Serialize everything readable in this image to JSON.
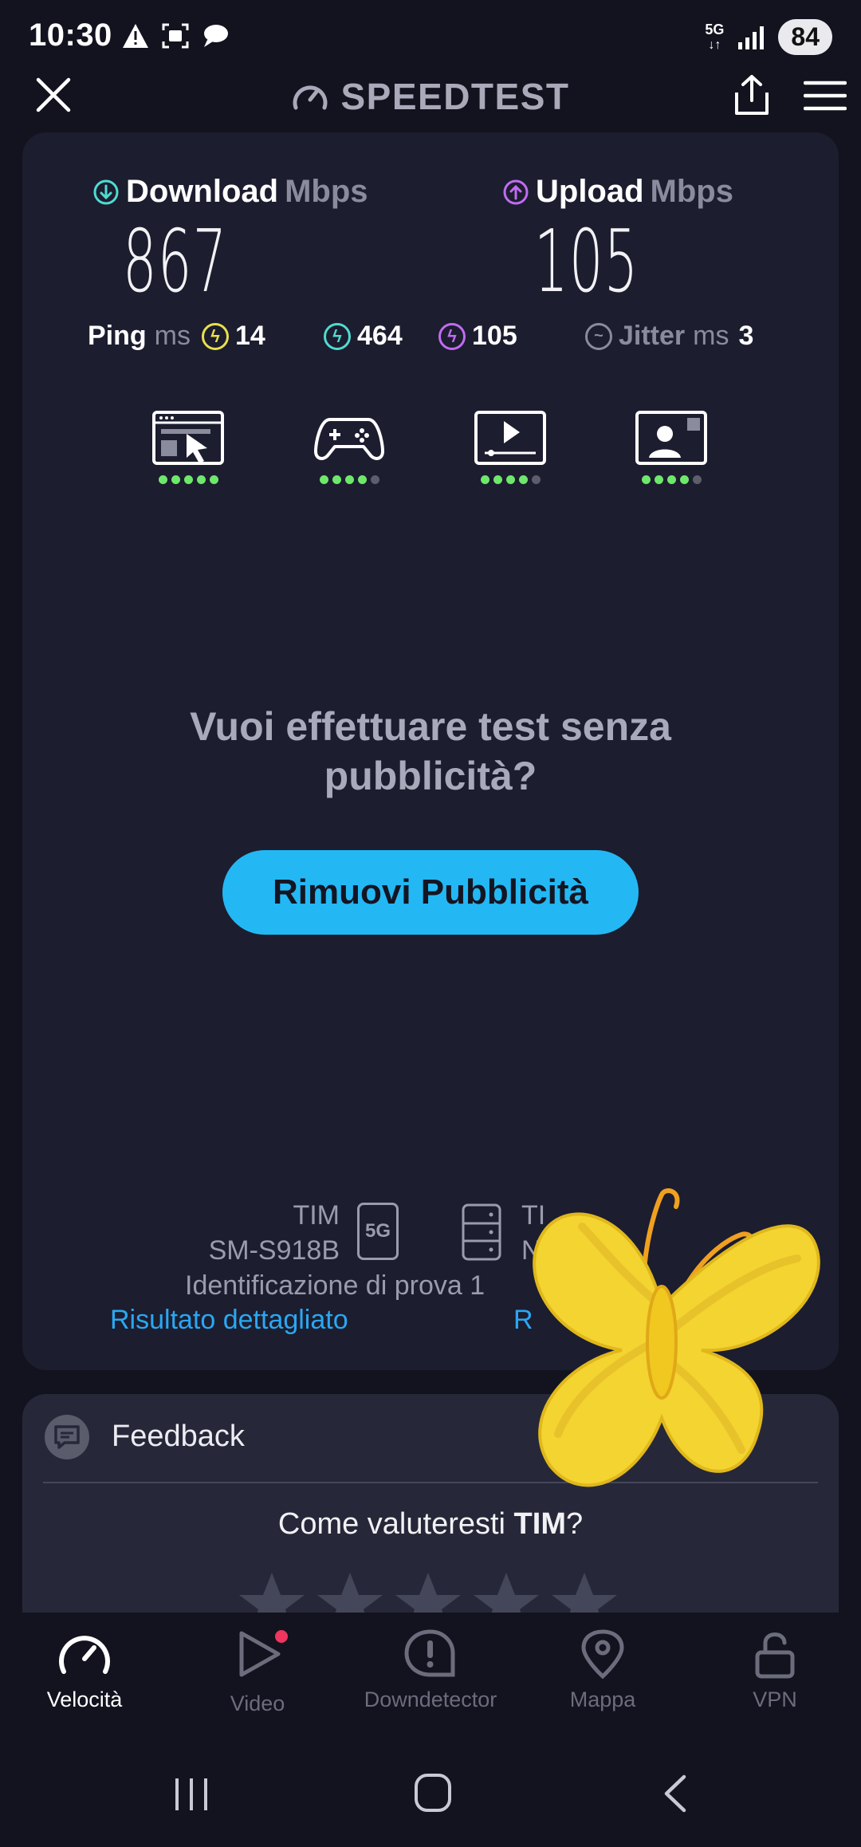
{
  "status_bar": {
    "time": "10:30",
    "battery": "84",
    "network": "5G"
  },
  "header": {
    "title": "SPEEDTEST",
    "icons": [
      "close-icon",
      "speedometer-icon",
      "share-icon",
      "menu-icon"
    ]
  },
  "results": {
    "download": {
      "label": "Download",
      "unit": "Mbps",
      "value": "867"
    },
    "upload": {
      "label": "Upload",
      "unit": "Mbps",
      "value": "105"
    },
    "ping": {
      "label": "Ping",
      "unit": "ms",
      "idle": "14",
      "download": "464",
      "upload": "105"
    },
    "jitter": {
      "label": "Jitter",
      "unit": "ms",
      "value": "3"
    }
  },
  "quality_ratings": [
    {
      "name": "browsing",
      "icon": "browser-cursor-icon",
      "score": 5
    },
    {
      "name": "gaming",
      "icon": "gamepad-icon",
      "score": 4
    },
    {
      "name": "streaming",
      "icon": "video-play-icon",
      "score": 4
    },
    {
      "name": "video-call",
      "icon": "video-call-icon",
      "score": 4
    }
  ],
  "promo": {
    "question": "Vuoi effettuare test senza pubblicità?",
    "button_label": "Rimuovi Pubblicità"
  },
  "connection": {
    "provider": "TIM",
    "device": "SM-S918B",
    "network_badge": "5G",
    "server_provider": "TI",
    "server_location": "Na",
    "test_id": "Identificazione di prova 1",
    "detail_link": "Risultato dettagliato",
    "other_link": "R"
  },
  "feedback": {
    "title": "Feedback",
    "question_prefix": "Come valuteresti ",
    "provider": "TIM",
    "question_suffix": "?",
    "stars": 5
  },
  "bottom_nav": [
    {
      "label": "Velocità",
      "icon": "speedometer-icon",
      "active": true
    },
    {
      "label": "Video",
      "icon": "play-icon",
      "active": false
    },
    {
      "label": "Downdetector",
      "icon": "alert-bubble-icon",
      "active": false
    },
    {
      "label": "Mappa",
      "icon": "map-pin-icon",
      "active": false
    },
    {
      "label": "VPN",
      "icon": "unlock-icon",
      "active": false
    }
  ],
  "colors": {
    "background": "#12131f",
    "card": "#1c1d2f",
    "accent_blue": "#23b8f4",
    "download_teal": "#4fdbd0",
    "upload_purple": "#c06cf0",
    "ping_yellow": "#e9e04c",
    "good_green": "#6ee86b",
    "sticker_yellow": "#f4d430"
  }
}
